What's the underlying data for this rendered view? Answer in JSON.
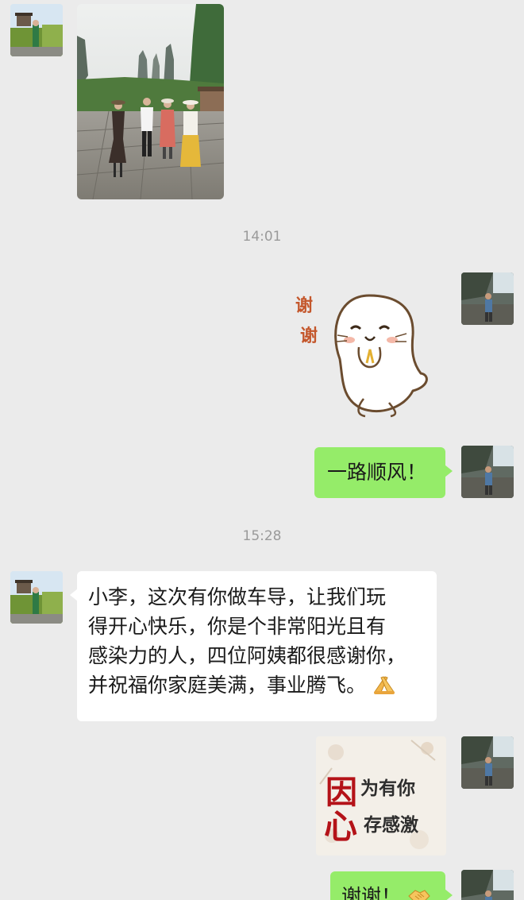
{
  "messages": {
    "time_1": "14:01",
    "time_2": "15:28",
    "sticker_text": "谢谢",
    "bubble_1": "一路顺风！",
    "long_message": {
      "line1": "小李，这次有你做车导，让我们玩",
      "line2": "得开心快乐，你是个非常阳光且有",
      "line3": "感染力的人，四位阿姨都很感谢你，",
      "line4": "并祝福你家庭美满，事业腾飞。"
    },
    "image_card": {
      "char1": "因",
      "line1_rest": "为有你",
      "char2": "心",
      "line2_rest": "存感激"
    },
    "last_bubble": "谢谢！"
  },
  "icons": {
    "clasped_hands": "clasped-hands-emoji",
    "handshake": "handshake-emoji"
  },
  "colors": {
    "background": "#ebebeb",
    "sent_bubble": "#95ec69",
    "received_bubble": "#ffffff",
    "timestamp": "#9a9a9a"
  }
}
